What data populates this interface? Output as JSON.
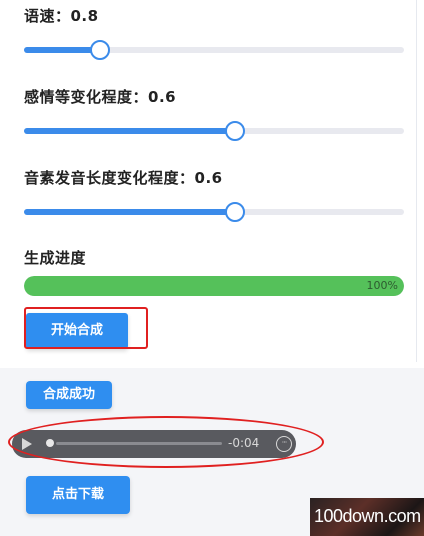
{
  "settings": {
    "speed": {
      "label": "语速：0.8",
      "value_fraction": 0.2
    },
    "emotion": {
      "label": "感情等变化程度：0.6",
      "value_fraction": 0.555
    },
    "phoneme": {
      "label": "音素发音长度变化程度：0.6",
      "value_fraction": 0.555
    }
  },
  "progress": {
    "label": "生成进度",
    "percent": 100,
    "percent_text": "100%",
    "color": "#55c15a"
  },
  "actions": {
    "start_label": "开始合成",
    "download_label": "点击下载"
  },
  "status": {
    "success_label": "合成成功"
  },
  "audio": {
    "time": "-0:04",
    "more": "···"
  },
  "watermark": {
    "text": "100down.com"
  },
  "colors": {
    "accent": "#2f8ef0",
    "highlight": "#e02020"
  }
}
